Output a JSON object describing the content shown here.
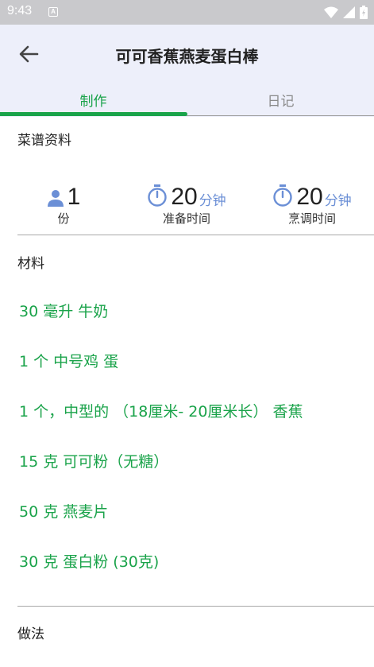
{
  "status_bar": {
    "time": "9:43",
    "notification_letter": "A"
  },
  "header": {
    "title": "可可香蕉燕麦蛋白棒"
  },
  "tabs": [
    {
      "label": "制作",
      "selected": true
    },
    {
      "label": "日记",
      "selected": false
    }
  ],
  "recipe_info": {
    "label": "菜谱资料",
    "servings": {
      "value": "1",
      "caption": "份"
    },
    "prep_time": {
      "value": "20",
      "unit": "分钟",
      "caption": "准备时间"
    },
    "cook_time": {
      "value": "20",
      "unit": "分钟",
      "caption": "烹调时间"
    }
  },
  "ingredients": {
    "label": "材料",
    "items": [
      "30 毫升 牛奶",
      "1 个 中号鸡 蛋",
      "1 个，中型的 （18厘米- 20厘米长） 香蕉",
      "15 克 可可粉（无糖）",
      "50 克 燕麦片",
      "30 克 蛋白粉 (30克)"
    ]
  },
  "method": {
    "label": "做法"
  },
  "colors": {
    "accent": "#1aa34a",
    "unit_blue": "#6b8fd6",
    "appbar_bg": "#edeffa",
    "status_bg": "#c9c9cc"
  }
}
